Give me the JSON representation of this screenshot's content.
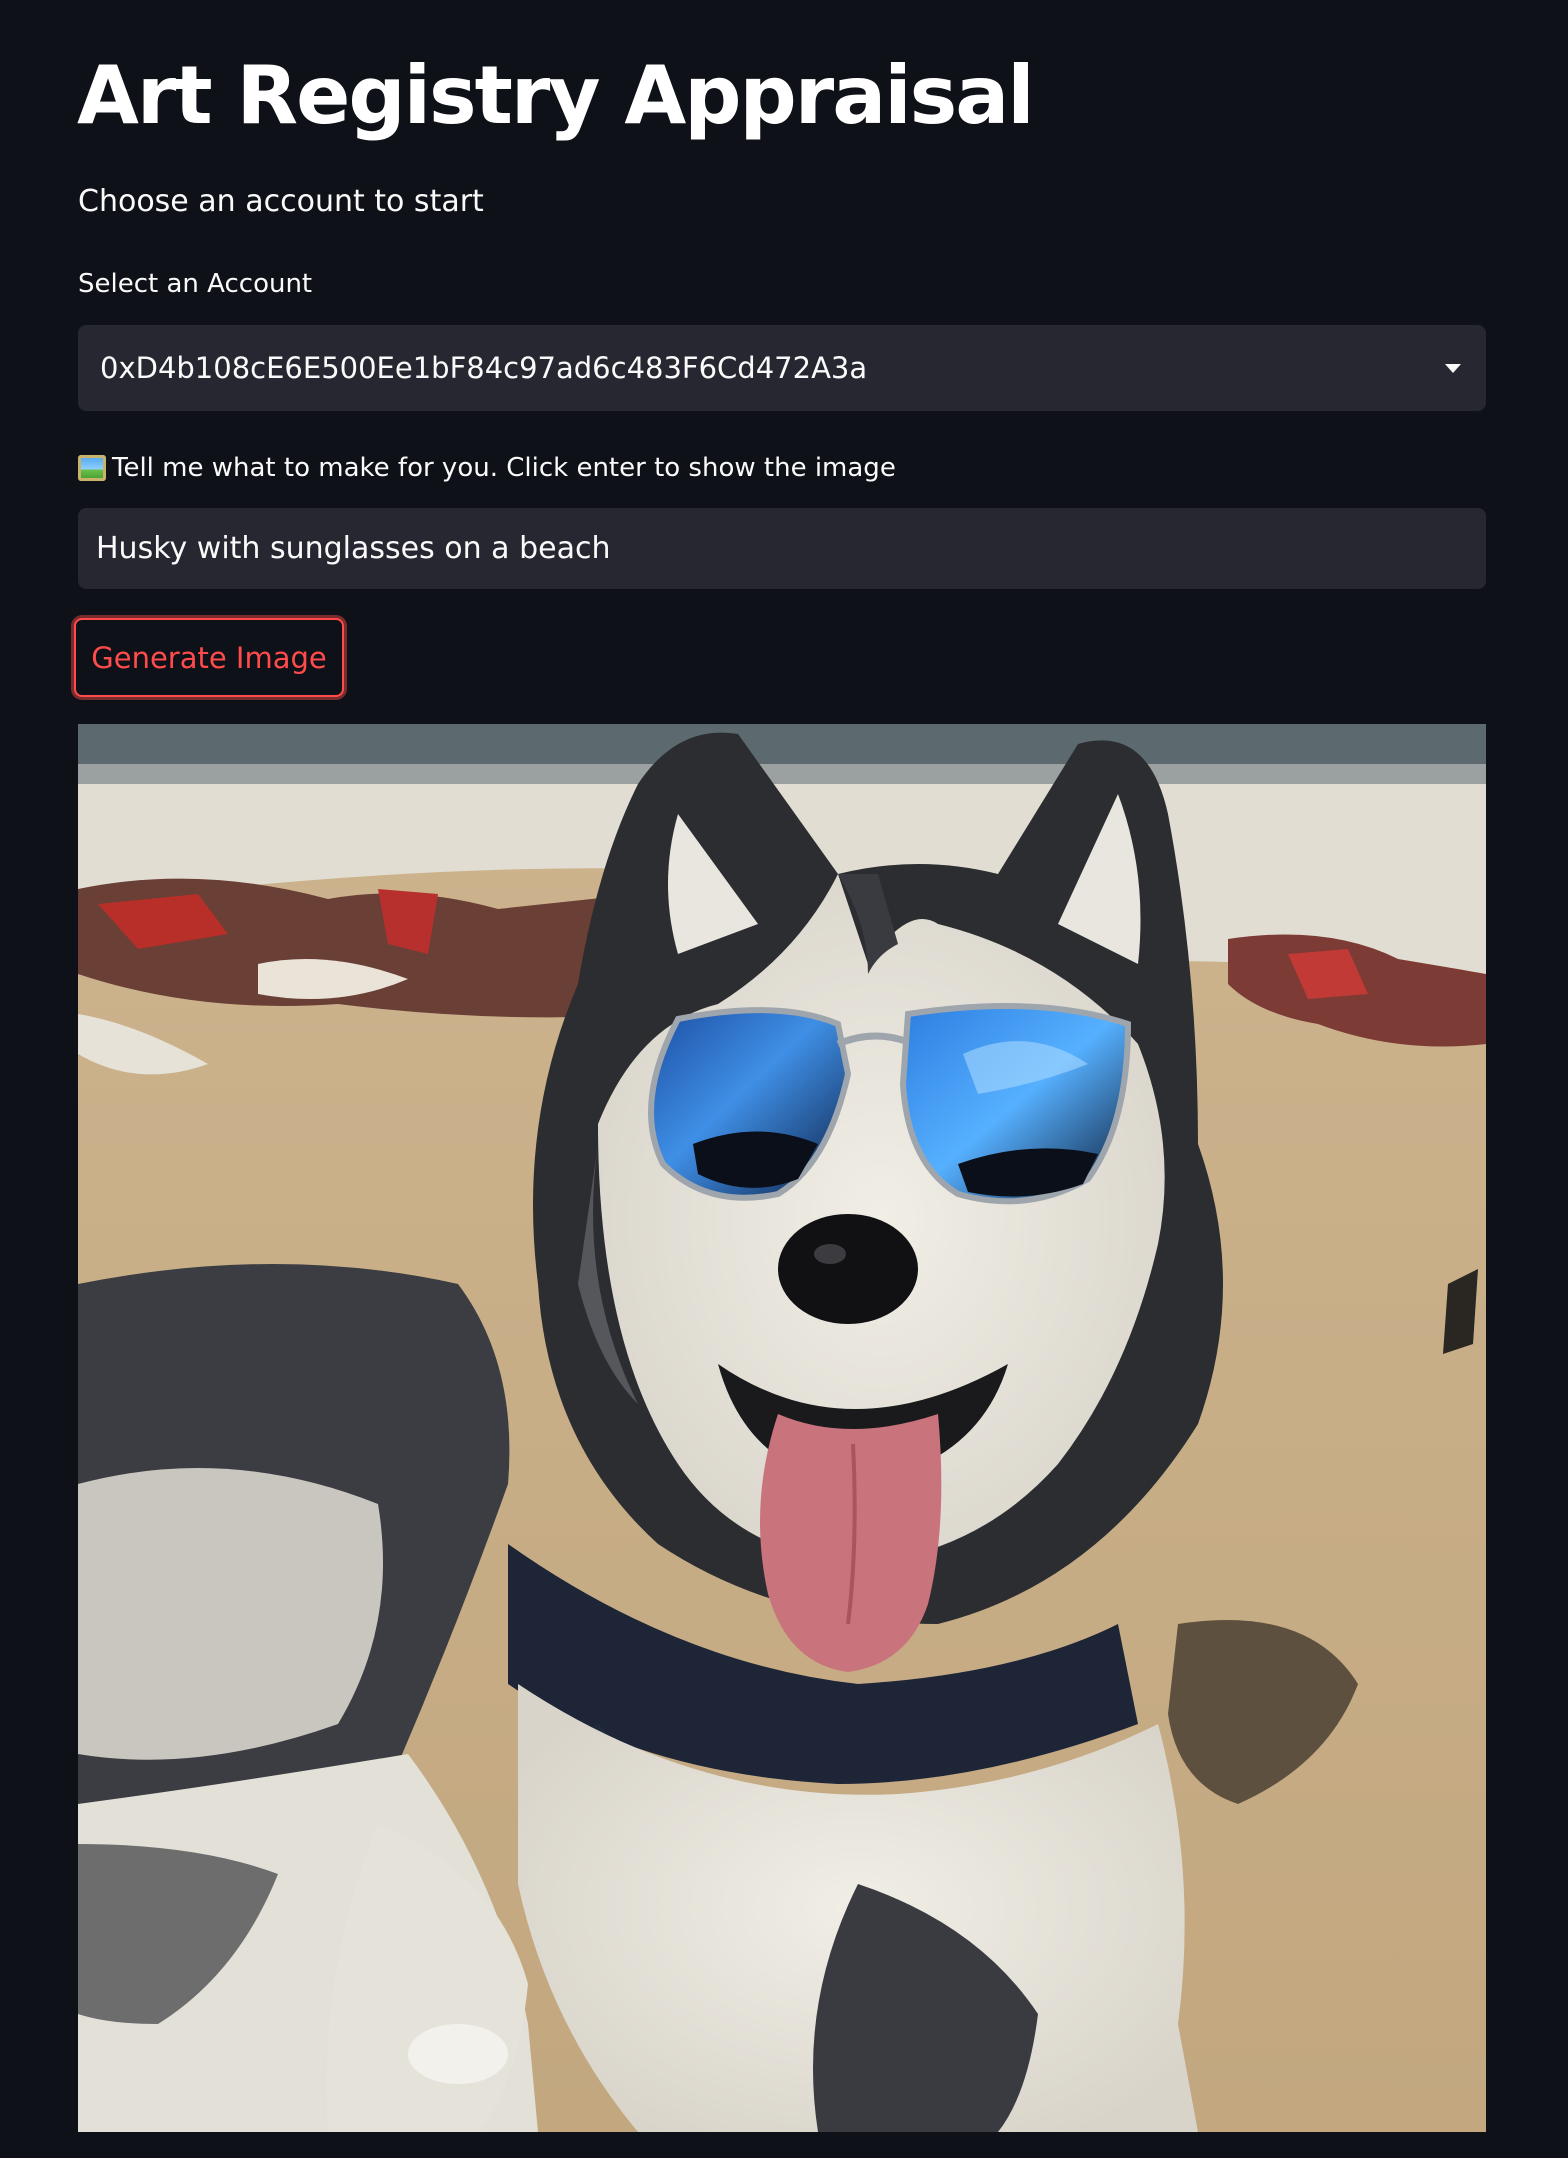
{
  "page": {
    "title": "Art Registry Appraisal",
    "subtitle": "Choose an account to start"
  },
  "account_select": {
    "label": "Select an Account",
    "selected_value": "0xD4b108cE6E500Ee1bF84c97ad6c483F6Cd472A3a"
  },
  "prompt_input": {
    "icon": "framed-picture-icon",
    "label": "Tell me what to make for you. Click enter to show the image",
    "value": "Husky with sunglasses on a beach"
  },
  "generate_button": {
    "label": "Generate Image"
  },
  "generated_image": {
    "alt": "Husky with sunglasses on a beach"
  },
  "colors": {
    "background": "#0e1117",
    "widget_background": "#262730",
    "accent": "#ff4b4b",
    "text": "#fafafa"
  }
}
